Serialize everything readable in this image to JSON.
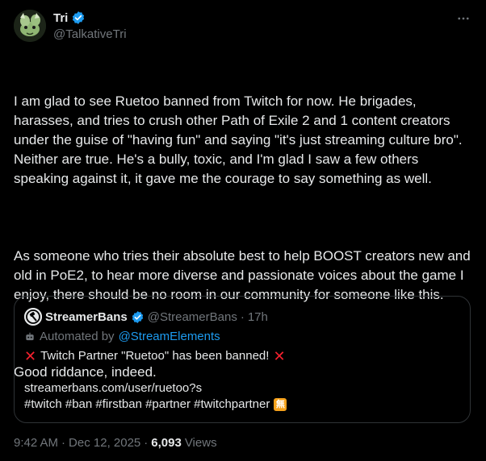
{
  "author": {
    "display_name": "Tri",
    "handle": "@TalkativeTri",
    "avatar_icon": "dragon-avatar-icon",
    "verified": true
  },
  "menu": {
    "icon": "more-options-icon"
  },
  "tweet": {
    "paragraphs": [
      "I am glad to see Ruetoo banned from Twitch for now. He brigades, harasses, and tries to crush other Path of Exile 2 and 1 content creators under the guise of \"having fun\" and saying \"it's just streaming culture bro\". Neither are true. He's a bully, toxic, and I'm glad I saw a few others speaking against it, it gave me the courage to say something as well.",
      "As someone who tries their absolute best to help BOOST creators new and old in PoE2, to hear more diverse and passionate voices about the game I enjoy, there should be no room in our community for someone like this.",
      "Good riddance, indeed."
    ]
  },
  "quote": {
    "display_name": "StreamerBans",
    "handle": "@StreamerBans",
    "separator": "·",
    "time": "17h",
    "automated_prefix": "Automated by",
    "automated_by": "@StreamElements",
    "ban_line": "Twitch Partner \"Ruetoo\" has been banned!",
    "url": "streamerbans.com/user/ruetoo?s",
    "hashtags": "#twitch #ban #firstban #partner #twitchpartner",
    "badge_glyph": "無"
  },
  "footer": {
    "time": "9:42 AM",
    "date": "Dec 12, 2025",
    "separator": "·",
    "views_count": "6,093",
    "views_label": "Views"
  },
  "colors": {
    "background": "#000000",
    "text": "#e7e9ea",
    "secondary": "#71767b",
    "accent": "#1d9bf0",
    "border": "#2f3336",
    "red": "#f4212e"
  }
}
